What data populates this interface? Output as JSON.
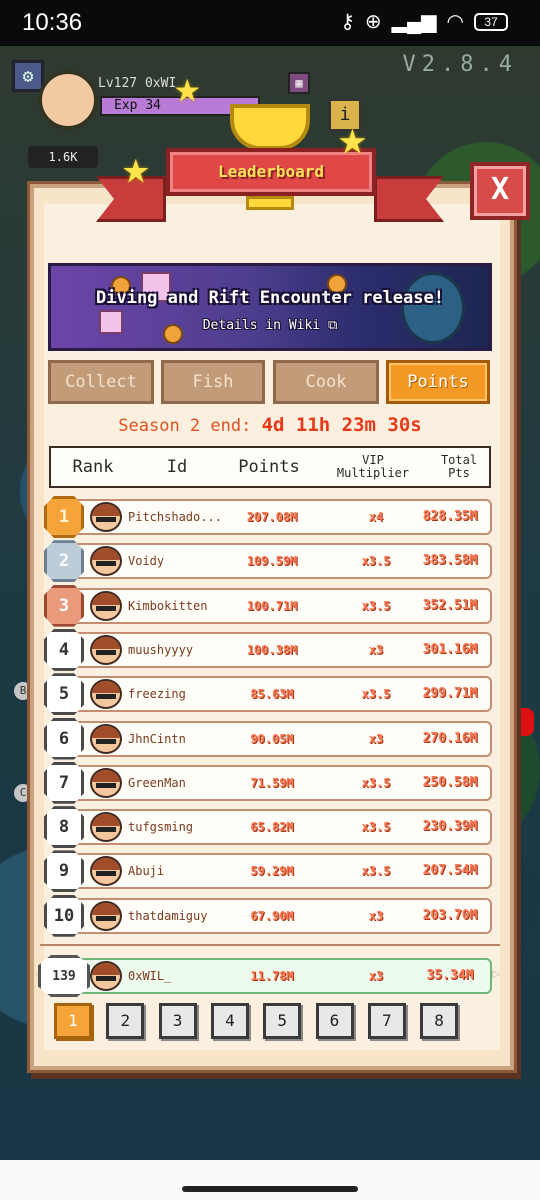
{
  "status_bar": {
    "time": "10:36",
    "battery": "37"
  },
  "hud": {
    "version": "V2.8.4",
    "level": "Lv127 0xWI",
    "exp_label": "Exp",
    "exp_value": "34",
    "coins": "1.6K"
  },
  "header": {
    "title": "Leaderboard",
    "close_label": "X"
  },
  "banner": {
    "title": "Diving and Rift Encounter release!",
    "subtitle": "Details in Wiki"
  },
  "tabs": [
    {
      "label": "Collect",
      "active": false
    },
    {
      "label": "Fish",
      "active": false
    },
    {
      "label": "Cook",
      "active": false
    },
    {
      "label": "Points",
      "active": true
    }
  ],
  "season": {
    "label": "Season 2 end:",
    "countdown": "4d 11h 23m 30s"
  },
  "columns": {
    "rank": "Rank",
    "id": "Id",
    "points": "Points",
    "vip_line1": "VIP",
    "vip_line2": "Multiplier",
    "total_line1": "Total",
    "total_line2": "Pts"
  },
  "rows": [
    {
      "rank": "1",
      "name": "Pitchshado...",
      "points": "207.08M",
      "mult": "x4",
      "total": "828.35M"
    },
    {
      "rank": "2",
      "name": "Voidy",
      "points": "109.59M",
      "mult": "x3.5",
      "total": "383.58M"
    },
    {
      "rank": "3",
      "name": "Kimbokitten",
      "points": "100.71M",
      "mult": "x3.5",
      "total": "352.51M"
    },
    {
      "rank": "4",
      "name": "muushyyyy",
      "points": "100.38M",
      "mult": "x3",
      "total": "301.16M"
    },
    {
      "rank": "5",
      "name": "freezing",
      "points": "85.63M",
      "mult": "x3.5",
      "total": "299.71M"
    },
    {
      "rank": "6",
      "name": "JhnCintn",
      "points": "90.05M",
      "mult": "x3",
      "total": "270.16M"
    },
    {
      "rank": "7",
      "name": "GreenMan",
      "points": "71.59M",
      "mult": "x3.5",
      "total": "250.58M"
    },
    {
      "rank": "8",
      "name": "tufgsming",
      "points": "65.82M",
      "mult": "x3.5",
      "total": "230.39M"
    },
    {
      "rank": "9",
      "name": "Abuji",
      "points": "59.29M",
      "mult": "x3.5",
      "total": "207.54M"
    },
    {
      "rank": "10",
      "name": "thatdamiguy",
      "points": "67.90M",
      "mult": "x3",
      "total": "203.70M"
    }
  ],
  "me": {
    "rank": "139",
    "name": "0xWIL_",
    "points": "11.78M",
    "mult": "x3",
    "total": "35.34M"
  },
  "pages": [
    "1",
    "2",
    "3",
    "4",
    "5",
    "6",
    "7",
    "8"
  ],
  "current_page": "1",
  "colors": {
    "panel": "#f7e4c9",
    "ribbon": "#e04848",
    "active_tab": "#f49a24",
    "countdown": "#e83a1a",
    "value_text": "#ff7a55"
  }
}
